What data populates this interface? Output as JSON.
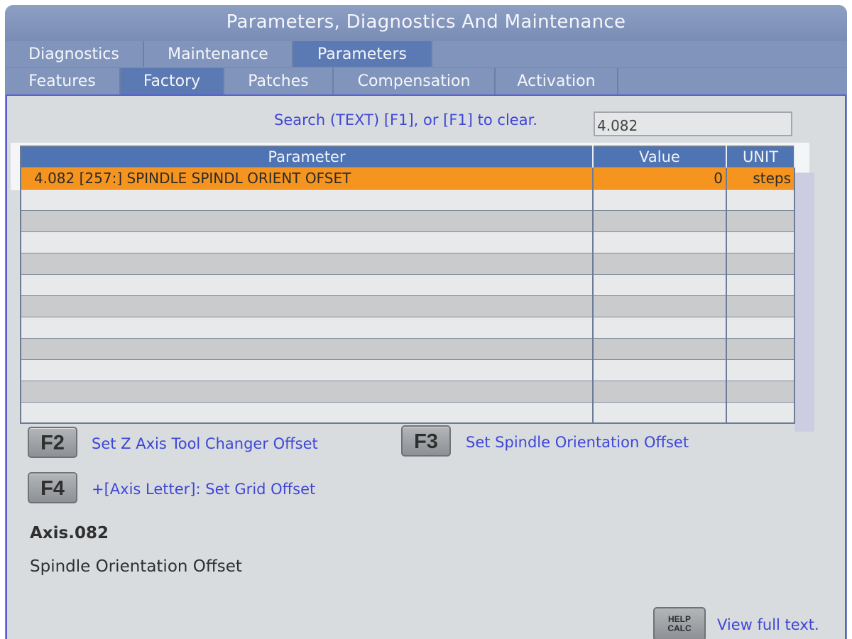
{
  "window": {
    "title": "Parameters, Diagnostics And Maintenance"
  },
  "tabs_primary": [
    {
      "label": "Diagnostics",
      "active": false
    },
    {
      "label": "Maintenance",
      "active": false
    },
    {
      "label": "Parameters",
      "active": true
    }
  ],
  "tabs_secondary": [
    {
      "label": "Features",
      "active": false
    },
    {
      "label": "Factory",
      "active": true
    },
    {
      "label": "Patches",
      "active": false
    },
    {
      "label": "Compensation",
      "active": false
    },
    {
      "label": "Activation",
      "active": false
    }
  ],
  "search": {
    "label": "Search (TEXT) [F1], or [F1] to clear.",
    "value": "4.082"
  },
  "table": {
    "headers": {
      "parameter": "Parameter",
      "value": "Value",
      "unit": "UNIT"
    },
    "rows": [
      {
        "parameter": "4.082 [257:]  SPINDLE SPINDL ORIENT OFSET",
        "value": "0",
        "unit": "steps",
        "selected": true
      }
    ]
  },
  "function_keys": [
    {
      "key": "F2",
      "description": "Set Z Axis Tool Changer Offset"
    },
    {
      "key": "F3",
      "description": "Set Spindle Orientation Offset"
    },
    {
      "key": "F4",
      "description": "+[Axis Letter]: Set Grid Offset"
    }
  ],
  "detail": {
    "title": "Axis.082",
    "description": "Spindle Orientation Offset"
  },
  "help": {
    "key_line1": "HELP",
    "key_line2": "CALC",
    "link": "View full text."
  },
  "colors": {
    "title_bar": "#7a8db5",
    "active_tab": "#5b79b2",
    "selected_row": "#f5941f",
    "link_text": "#3e46d6",
    "panel_bg": "#d9dcdf"
  }
}
